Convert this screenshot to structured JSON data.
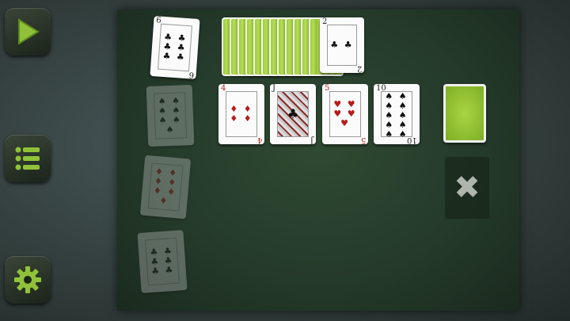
{
  "sidebar": {
    "buttons": [
      {
        "name": "play-icon"
      },
      {
        "name": "menu-icon"
      },
      {
        "name": "gear-icon"
      }
    ]
  },
  "colors": {
    "accent": "#8fc23a",
    "felt": "#2f4a32"
  },
  "cards": {
    "waste_top": {
      "rank": "6",
      "suit": "♣",
      "pips": "♣ ♣ ♣ ♣ ♣ ♣"
    },
    "fan_top": {
      "rank": "2",
      "suit": "♣",
      "pips": "♣ ♣"
    },
    "row": [
      {
        "rank": "4",
        "suit": "♦",
        "pips": "♦ ♦ ♦ ♦",
        "red": true
      },
      {
        "rank": "J",
        "suit": "♣",
        "pips": "♣",
        "red": false
      },
      {
        "rank": "5",
        "suit": "♥",
        "pips": "♥ ♥ ♥ ♥ ♥",
        "red": true
      },
      {
        "rank": "10",
        "suit": "♠",
        "pips": "♠ ♠ ♠ ♠ ♠ ♠ ♠ ♠ ♠ ♠",
        "red": false
      }
    ],
    "ghosts": [
      {
        "suit": "♠",
        "pips": "♠ ♠ ♠ ♠ ♠ ♠ ♠",
        "red": false
      },
      {
        "suit": "♦",
        "pips": "♦ ♦ ♦ ♦ ♦ ♦ ♦",
        "red": true
      },
      {
        "suit": "♣",
        "pips": "♣ ♣ ♣ ♣ ♣ ♣",
        "red": false
      }
    ]
  },
  "discard_label": "✖"
}
